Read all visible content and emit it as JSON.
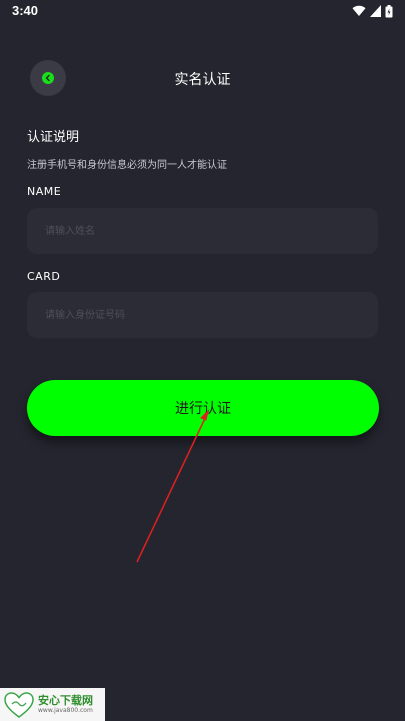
{
  "status_bar": {
    "time": "3:40",
    "icons": [
      "wifi-icon",
      "signal-icon",
      "battery-icon"
    ]
  },
  "header": {
    "back_icon": "chevron-left-icon",
    "title": "实名认证"
  },
  "section": {
    "title": "认证说明",
    "description": "注册手机号和身份信息必须为同一人才能认证"
  },
  "form": {
    "name_label": "NAME",
    "name_placeholder": "请输入姓名",
    "name_value": "",
    "card_label": "CARD",
    "card_placeholder": "请输入身份证号码",
    "card_value": ""
  },
  "submit": {
    "label": "进行认证"
  },
  "watermark": {
    "name": "安心下载网",
    "url": "www.java800.com"
  },
  "colors": {
    "background": "#24252e",
    "accent": "#00ff00",
    "field_bg": "#2b2c36",
    "annotation": "#e02020"
  }
}
